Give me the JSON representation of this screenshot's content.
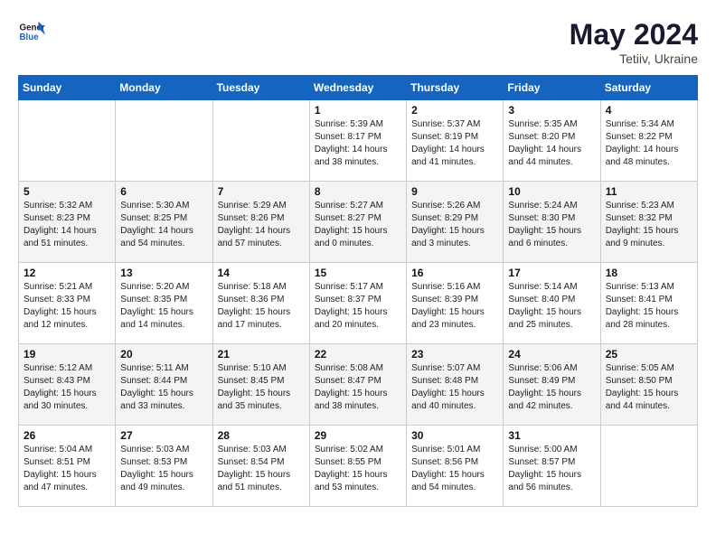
{
  "header": {
    "logo_line1": "General",
    "logo_line2": "Blue",
    "month_year": "May 2024",
    "location": "Tetiiv, Ukraine"
  },
  "weekdays": [
    "Sunday",
    "Monday",
    "Tuesday",
    "Wednesday",
    "Thursday",
    "Friday",
    "Saturday"
  ],
  "weeks": [
    [
      {
        "day": "",
        "info": ""
      },
      {
        "day": "",
        "info": ""
      },
      {
        "day": "",
        "info": ""
      },
      {
        "day": "1",
        "info": "Sunrise: 5:39 AM\nSunset: 8:17 PM\nDaylight: 14 hours\nand 38 minutes."
      },
      {
        "day": "2",
        "info": "Sunrise: 5:37 AM\nSunset: 8:19 PM\nDaylight: 14 hours\nand 41 minutes."
      },
      {
        "day": "3",
        "info": "Sunrise: 5:35 AM\nSunset: 8:20 PM\nDaylight: 14 hours\nand 44 minutes."
      },
      {
        "day": "4",
        "info": "Sunrise: 5:34 AM\nSunset: 8:22 PM\nDaylight: 14 hours\nand 48 minutes."
      }
    ],
    [
      {
        "day": "5",
        "info": "Sunrise: 5:32 AM\nSunset: 8:23 PM\nDaylight: 14 hours\nand 51 minutes."
      },
      {
        "day": "6",
        "info": "Sunrise: 5:30 AM\nSunset: 8:25 PM\nDaylight: 14 hours\nand 54 minutes."
      },
      {
        "day": "7",
        "info": "Sunrise: 5:29 AM\nSunset: 8:26 PM\nDaylight: 14 hours\nand 57 minutes."
      },
      {
        "day": "8",
        "info": "Sunrise: 5:27 AM\nSunset: 8:27 PM\nDaylight: 15 hours\nand 0 minutes."
      },
      {
        "day": "9",
        "info": "Sunrise: 5:26 AM\nSunset: 8:29 PM\nDaylight: 15 hours\nand 3 minutes."
      },
      {
        "day": "10",
        "info": "Sunrise: 5:24 AM\nSunset: 8:30 PM\nDaylight: 15 hours\nand 6 minutes."
      },
      {
        "day": "11",
        "info": "Sunrise: 5:23 AM\nSunset: 8:32 PM\nDaylight: 15 hours\nand 9 minutes."
      }
    ],
    [
      {
        "day": "12",
        "info": "Sunrise: 5:21 AM\nSunset: 8:33 PM\nDaylight: 15 hours\nand 12 minutes."
      },
      {
        "day": "13",
        "info": "Sunrise: 5:20 AM\nSunset: 8:35 PM\nDaylight: 15 hours\nand 14 minutes."
      },
      {
        "day": "14",
        "info": "Sunrise: 5:18 AM\nSunset: 8:36 PM\nDaylight: 15 hours\nand 17 minutes."
      },
      {
        "day": "15",
        "info": "Sunrise: 5:17 AM\nSunset: 8:37 PM\nDaylight: 15 hours\nand 20 minutes."
      },
      {
        "day": "16",
        "info": "Sunrise: 5:16 AM\nSunset: 8:39 PM\nDaylight: 15 hours\nand 23 minutes."
      },
      {
        "day": "17",
        "info": "Sunrise: 5:14 AM\nSunset: 8:40 PM\nDaylight: 15 hours\nand 25 minutes."
      },
      {
        "day": "18",
        "info": "Sunrise: 5:13 AM\nSunset: 8:41 PM\nDaylight: 15 hours\nand 28 minutes."
      }
    ],
    [
      {
        "day": "19",
        "info": "Sunrise: 5:12 AM\nSunset: 8:43 PM\nDaylight: 15 hours\nand 30 minutes."
      },
      {
        "day": "20",
        "info": "Sunrise: 5:11 AM\nSunset: 8:44 PM\nDaylight: 15 hours\nand 33 minutes."
      },
      {
        "day": "21",
        "info": "Sunrise: 5:10 AM\nSunset: 8:45 PM\nDaylight: 15 hours\nand 35 minutes."
      },
      {
        "day": "22",
        "info": "Sunrise: 5:08 AM\nSunset: 8:47 PM\nDaylight: 15 hours\nand 38 minutes."
      },
      {
        "day": "23",
        "info": "Sunrise: 5:07 AM\nSunset: 8:48 PM\nDaylight: 15 hours\nand 40 minutes."
      },
      {
        "day": "24",
        "info": "Sunrise: 5:06 AM\nSunset: 8:49 PM\nDaylight: 15 hours\nand 42 minutes."
      },
      {
        "day": "25",
        "info": "Sunrise: 5:05 AM\nSunset: 8:50 PM\nDaylight: 15 hours\nand 44 minutes."
      }
    ],
    [
      {
        "day": "26",
        "info": "Sunrise: 5:04 AM\nSunset: 8:51 PM\nDaylight: 15 hours\nand 47 minutes."
      },
      {
        "day": "27",
        "info": "Sunrise: 5:03 AM\nSunset: 8:53 PM\nDaylight: 15 hours\nand 49 minutes."
      },
      {
        "day": "28",
        "info": "Sunrise: 5:03 AM\nSunset: 8:54 PM\nDaylight: 15 hours\nand 51 minutes."
      },
      {
        "day": "29",
        "info": "Sunrise: 5:02 AM\nSunset: 8:55 PM\nDaylight: 15 hours\nand 53 minutes."
      },
      {
        "day": "30",
        "info": "Sunrise: 5:01 AM\nSunset: 8:56 PM\nDaylight: 15 hours\nand 54 minutes."
      },
      {
        "day": "31",
        "info": "Sunrise: 5:00 AM\nSunset: 8:57 PM\nDaylight: 15 hours\nand 56 minutes."
      },
      {
        "day": "",
        "info": ""
      }
    ]
  ]
}
